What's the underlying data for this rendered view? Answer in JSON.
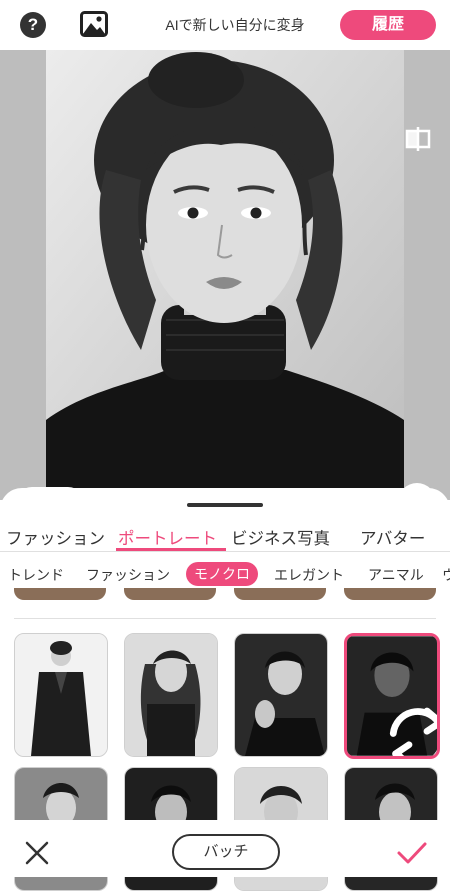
{
  "header": {
    "help_icon": "question-mark-icon",
    "gallery_icon": "image-gallery-icon",
    "help_glyph": "?",
    "title": "AIで新しい自分に変身",
    "history_label": "履歴"
  },
  "preview": {
    "compare_icon": "compare-split-icon",
    "download_icon": "download-icon",
    "gender": {
      "female_glyph": "♀",
      "male_glyph": "♂",
      "selected": "female"
    }
  },
  "categories": {
    "tabs": [
      "ファッション",
      "ポートレート",
      "ビジネス写真",
      "アバター"
    ],
    "active_index": 1
  },
  "subcategories": {
    "tabs": [
      "トレンド",
      "ファッション",
      "モノクロ",
      "エレガント",
      "アニマル",
      "ウ"
    ],
    "active_index": 2
  },
  "styles": {
    "selected_index": 3,
    "selected_overlay_icon": "regenerate-icon"
  },
  "bottom_bar": {
    "cancel_icon": "close-icon",
    "batch_label": "バッチ",
    "confirm_icon": "checkmark-icon"
  },
  "colors": {
    "accent": "#ee4a7c",
    "preview_bg": "#bdbdbd"
  }
}
